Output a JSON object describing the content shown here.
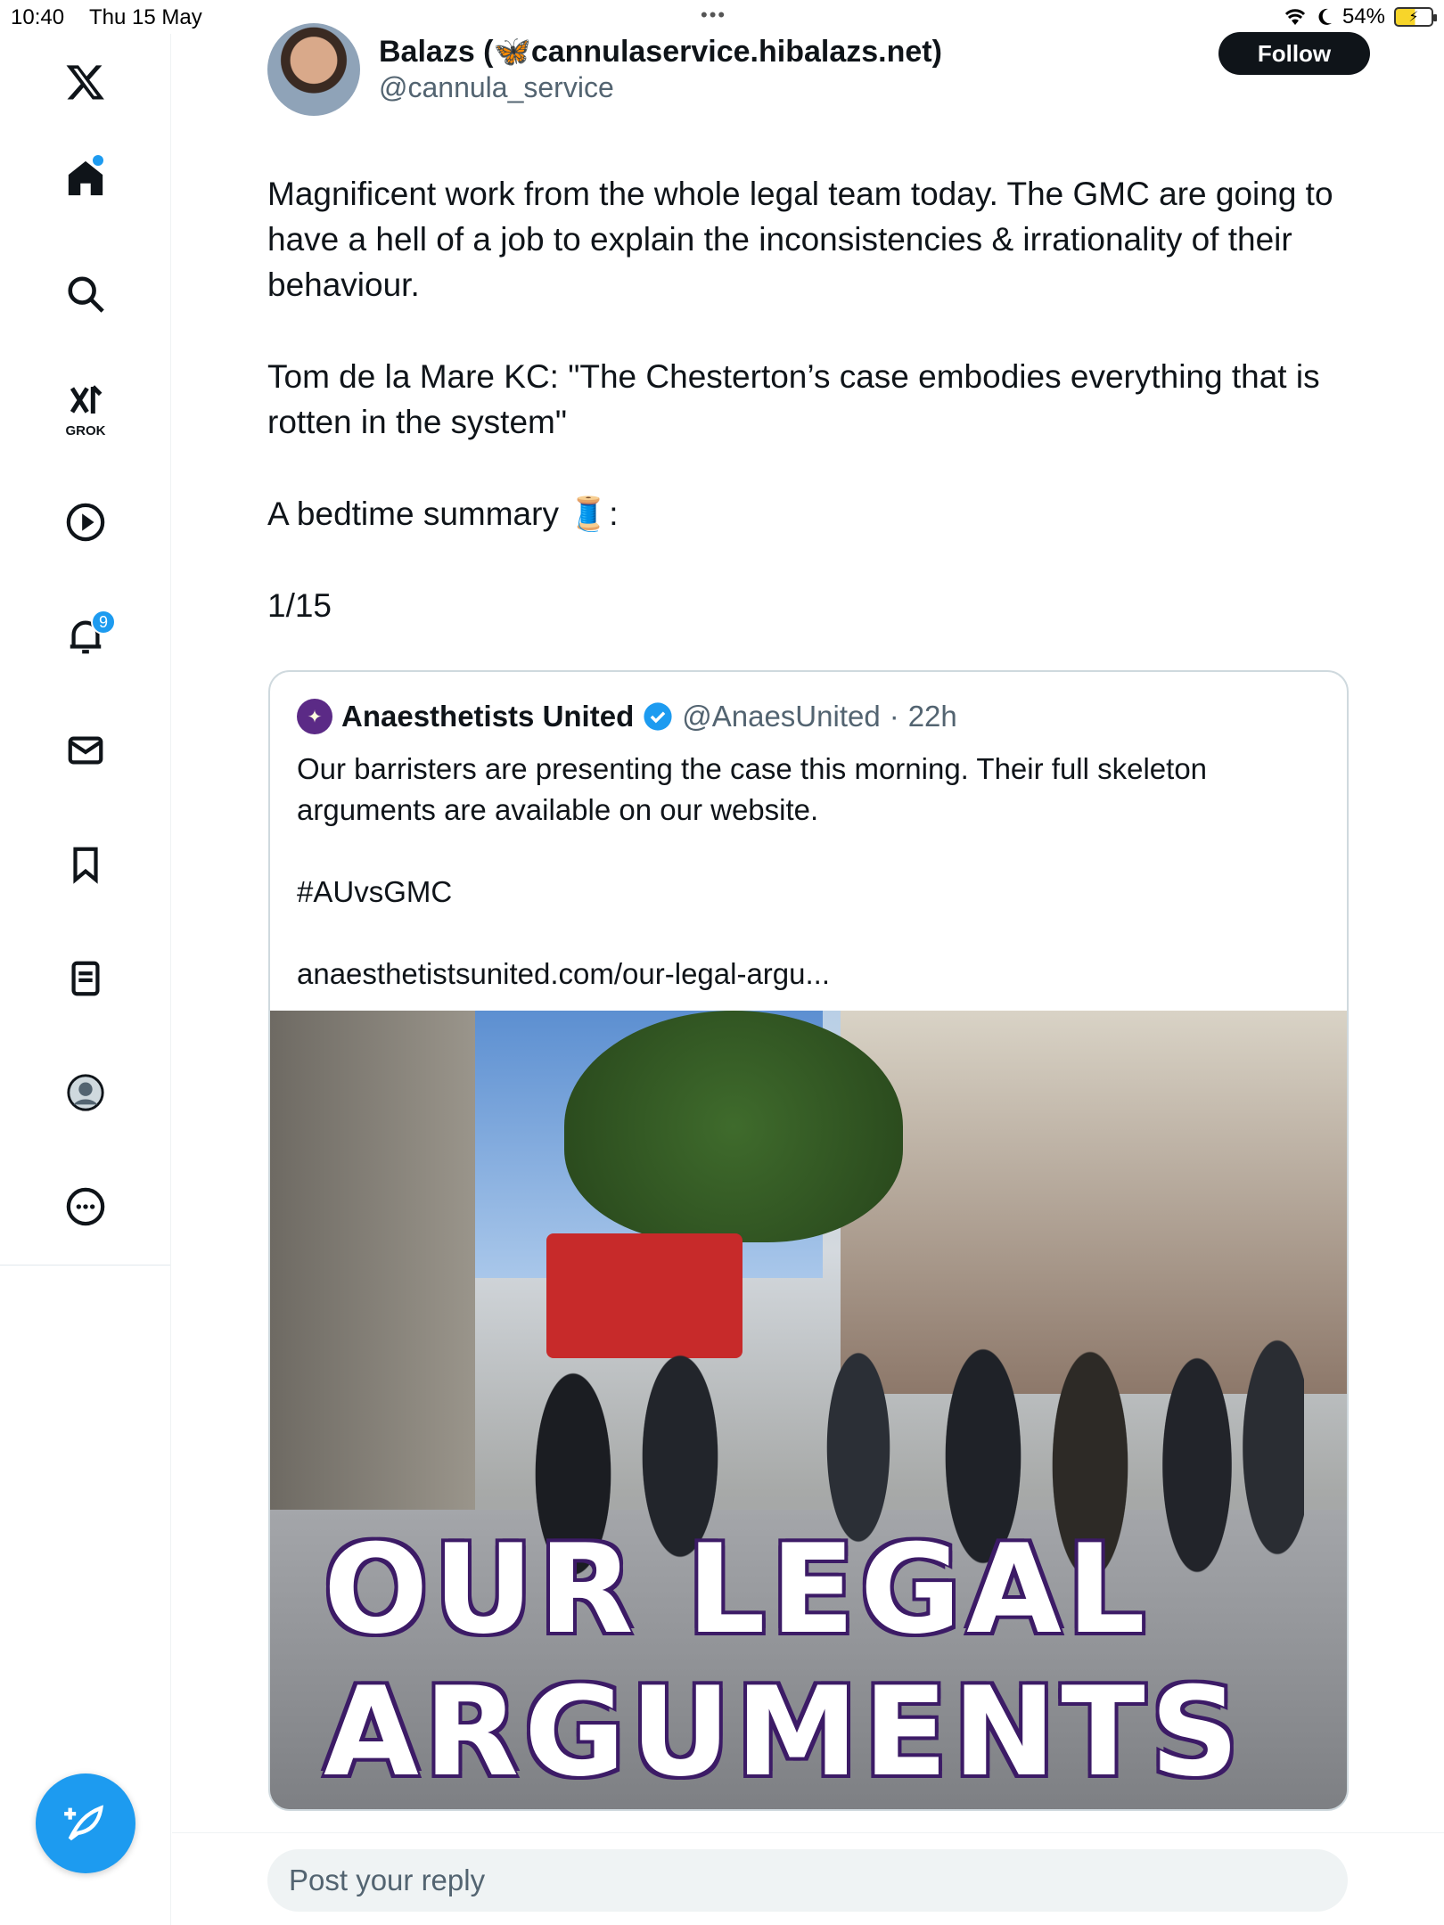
{
  "status_bar": {
    "time": "10:40",
    "date": "Thu 15 May",
    "dots": "•••",
    "battery": "54%"
  },
  "sidebar": {
    "items": [
      {
        "name": "x-logo",
        "icon": "x-logo-icon"
      },
      {
        "name": "home",
        "icon": "home-icon",
        "has_dot": true
      },
      {
        "name": "search",
        "icon": "search-icon"
      },
      {
        "name": "grok",
        "icon": "grok-icon",
        "label": "GROK"
      },
      {
        "name": "video",
        "icon": "play-icon"
      },
      {
        "name": "notifications",
        "icon": "bell-icon",
        "badge": "9"
      },
      {
        "name": "messages",
        "icon": "mail-icon"
      },
      {
        "name": "bookmarks",
        "icon": "bookmark-icon"
      },
      {
        "name": "lists",
        "icon": "list-icon"
      },
      {
        "name": "profile",
        "icon": "profile-icon"
      },
      {
        "name": "more",
        "icon": "more-icon"
      }
    ]
  },
  "post": {
    "author_name": "Balazs (🦋cannulaservice.hibalazs.net)",
    "author_handle": "@cannula_service",
    "follow_label": "Follow",
    "paragraphs": [
      "Magnificent work from the whole legal team today. The GMC are going to have a hell of a job to explain the inconsistencies & irrationality of their behaviour.",
      "Tom de la Mare KC: \"The Chesterton’s case embodies everything that is rotten in the system\"",
      "A bedtime summary 🧵:",
      "1/15"
    ]
  },
  "quote": {
    "name": "Anaesthetists United",
    "handle": "@AnaesUnited",
    "separator": "·",
    "time": "22h",
    "paragraphs": [
      "Our barristers are presenting the case this morning. Their full skeleton arguments are available on our website.",
      "#AUvsGMC",
      "anaesthetistsunited.com/our-legal-argu..."
    ],
    "image_text_line1": "OUR LEGAL",
    "image_text_line2": "ARGUMENTS"
  },
  "reply": {
    "placeholder": "Post your reply"
  },
  "colors": {
    "accent": "#1d9bf0",
    "text": "#0f1419",
    "muted": "#536471",
    "border": "#cfd9de",
    "brand_purple": "#3c1b66"
  }
}
